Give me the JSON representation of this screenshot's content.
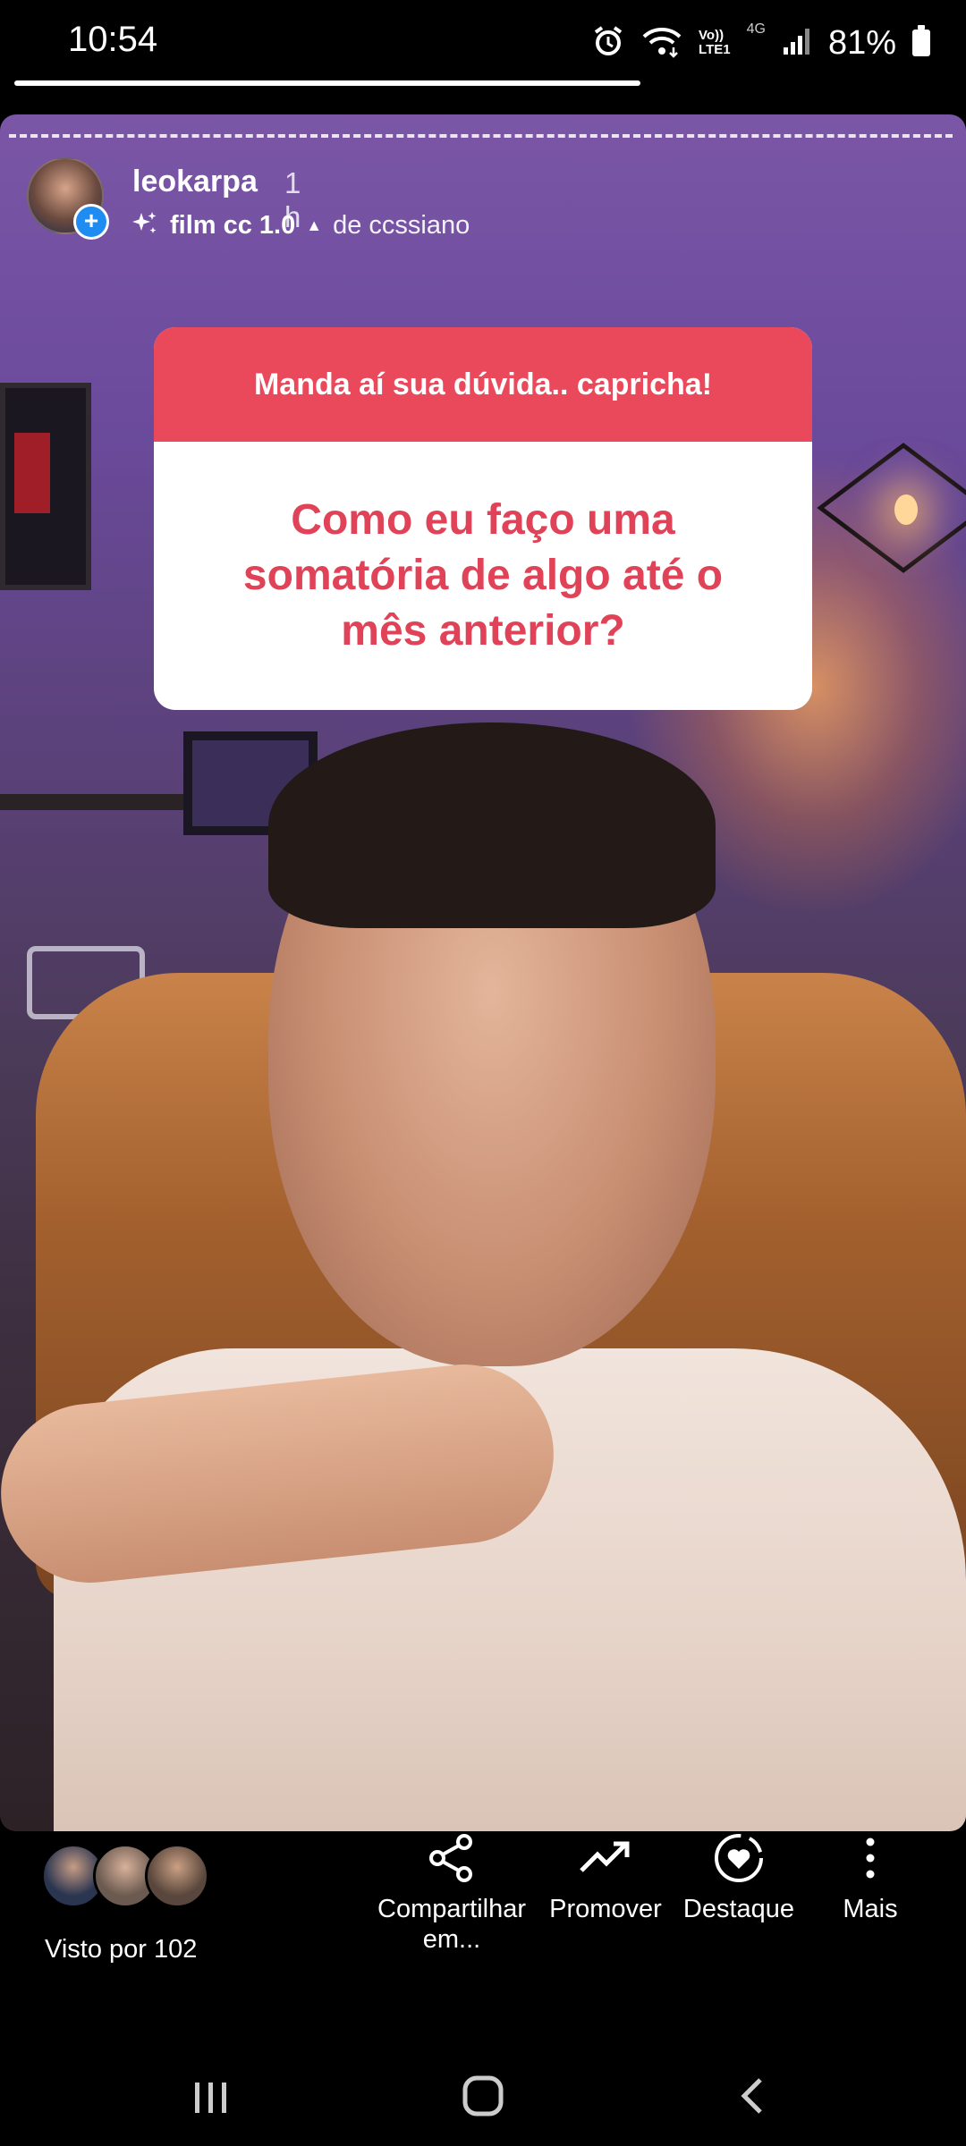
{
  "status_bar": {
    "time": "10:54",
    "volte": "Vo))\nLTE1",
    "network": "4G",
    "battery": "81%"
  },
  "story": {
    "username": "leokarpa",
    "posted_ago": "1 h",
    "effect_name": "film cc 1.0",
    "effect_author": "de ccssiano",
    "question_sticker": {
      "prompt": "Manda aí sua dúvida.. capricha!",
      "question": "Como eu faço uma somatória de algo até o mês anterior?",
      "header_color": "#e9495a",
      "text_color": "#e04358"
    }
  },
  "actions": {
    "seen_by": "Visto por 102",
    "share_label": "Compartilhar em...",
    "promote_label": "Promover",
    "highlight_label": "Destaque",
    "more_label": "Mais"
  },
  "icons": {
    "avatar_badge": "plus-icon",
    "effect": "sparkle-icon",
    "share": "share-icon",
    "promote": "trending-up-icon",
    "highlight": "heart-circle-icon",
    "more": "more-vertical-icon",
    "nav": [
      "recent-apps-icon",
      "home-icon",
      "back-icon"
    ]
  }
}
